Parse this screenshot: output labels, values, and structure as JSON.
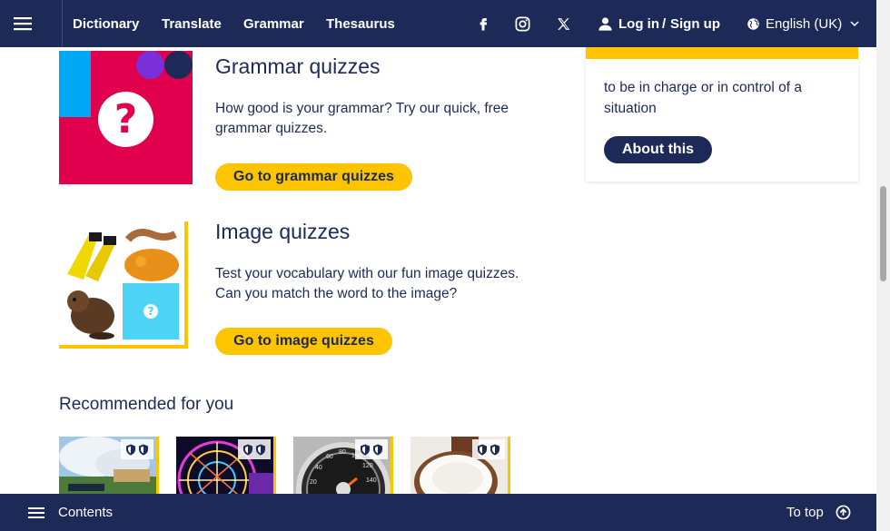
{
  "nav": {
    "menu_icon": "hamburger-icon",
    "links": [
      "Dictionary",
      "Translate",
      "Grammar",
      "Thesaurus"
    ],
    "social": [
      "facebook-icon",
      "instagram-icon",
      "x-icon"
    ],
    "login": "Log in",
    "slash": "/",
    "signup": "Sign up",
    "language": "English (UK)"
  },
  "grammar_quiz": {
    "title": "Grammar quizzes",
    "description": "How good is your grammar? Try our quick, free grammar quizzes.",
    "button": "Go to grammar quizzes",
    "image_glyph": "?"
  },
  "image_quiz": {
    "title": "Image quizzes",
    "description": "Test your vocabulary with our fun image quizzes. Can you match the word to the image?",
    "button": "Go to image quizzes",
    "image_glyph": "?"
  },
  "side_card": {
    "text": "to be in charge or in control of a situation",
    "button": "About this"
  },
  "recommended": {
    "heading": "Recommended for you",
    "cards": [
      "waterfront-photo",
      "ferris-wheel-photo",
      "speedometer-photo",
      "coconut-photo"
    ]
  },
  "speedometer_ticks": [
    "20",
    "40",
    "60",
    "80",
    "100",
    "120",
    "140"
  ],
  "bottom": {
    "contents": "Contents",
    "to_top": "To top"
  },
  "colors": {
    "navy": "#1d2a57",
    "yellow": "#fec400",
    "magenta": "#e0004d",
    "blue": "#00a8f5",
    "purple": "#7b2fd8"
  }
}
